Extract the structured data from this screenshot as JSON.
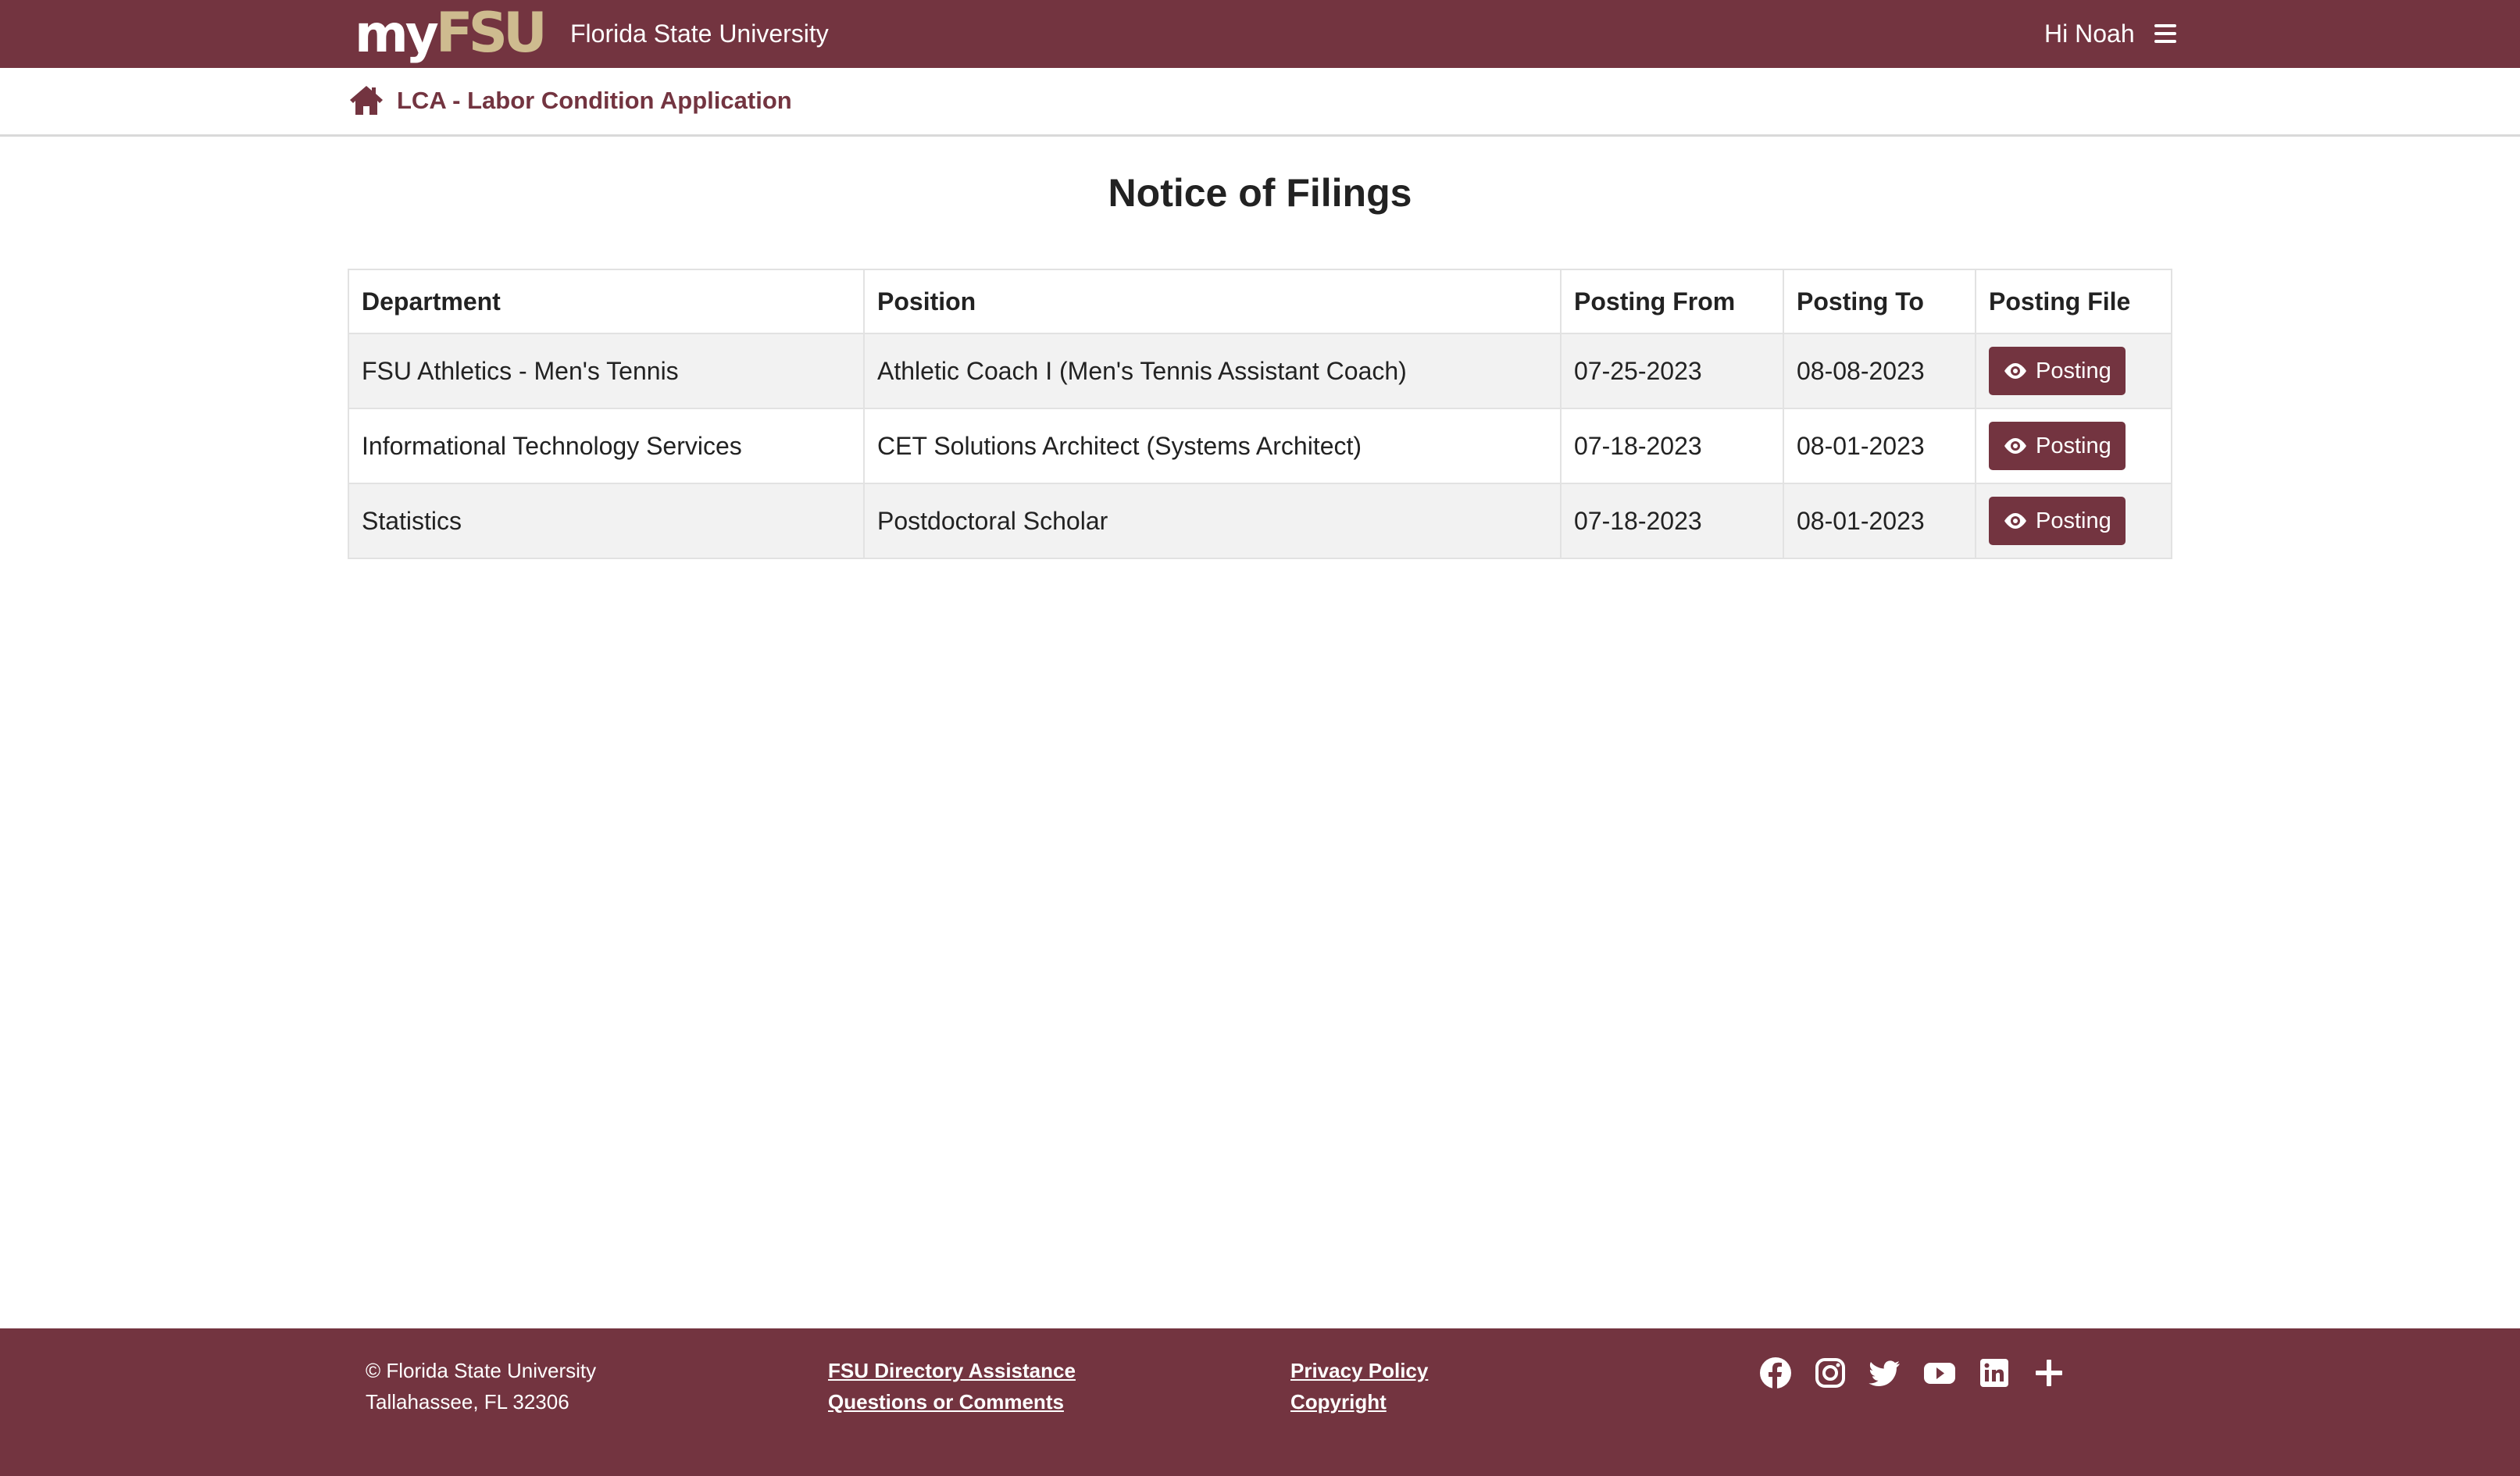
{
  "header": {
    "logo_my": "my",
    "logo_fsu": "FSU",
    "university": "Florida State University",
    "greeting": "Hi Noah",
    "menu_icon": "hamburger-menu-icon"
  },
  "subnav": {
    "home_icon": "home-icon",
    "app_title": "LCA - Labor Condition Application"
  },
  "main": {
    "title": "Notice of Filings",
    "table": {
      "headers": [
        "Department",
        "Position",
        "Posting From",
        "Posting To",
        "Posting File"
      ],
      "rows": [
        {
          "department": "FSU Athletics - Men's Tennis",
          "position": "Athletic Coach I (Men's Tennis Assistant Coach)",
          "from": "07-25-2023",
          "to": "08-08-2023",
          "file_label": "Posting"
        },
        {
          "department": "Informational Technology Services",
          "position": "CET Solutions Architect (Systems Architect)",
          "from": "07-18-2023",
          "to": "08-01-2023",
          "file_label": "Posting"
        },
        {
          "department": "Statistics",
          "position": "Postdoctoral Scholar",
          "from": "07-18-2023",
          "to": "08-01-2023",
          "file_label": "Posting"
        }
      ]
    }
  },
  "footer": {
    "copyright": "© Florida State University",
    "address": "Tallahassee, FL 32306",
    "links_col1": [
      "FSU Directory Assistance",
      "Questions or Comments"
    ],
    "links_col2": [
      "Privacy Policy",
      "Copyright"
    ],
    "social": [
      "facebook-icon",
      "instagram-icon",
      "twitter-icon",
      "youtube-icon",
      "linkedin-icon",
      "plus-icon"
    ]
  },
  "colors": {
    "brand_garnet": "#733440",
    "brand_gold": "#cebb8f",
    "row_stripe": "#f2f2f2"
  }
}
